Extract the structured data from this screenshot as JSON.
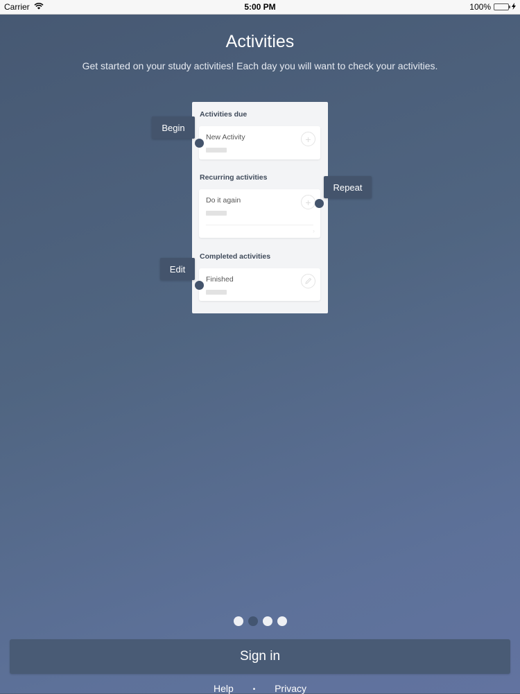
{
  "status_bar": {
    "carrier": "Carrier",
    "time": "5:00 PM",
    "battery": "100%"
  },
  "page": {
    "title": "Activities",
    "subtitle": "Get started on your study activities! Each day you will want to check your activities."
  },
  "mock": {
    "sections": [
      {
        "label": "Activities due",
        "item": "New Activity"
      },
      {
        "label": "Recurring activities",
        "item": "Do it again"
      },
      {
        "label": "Completed activities",
        "item": "Finished"
      }
    ]
  },
  "callouts": {
    "begin": "Begin",
    "repeat": "Repeat",
    "edit": "Edit"
  },
  "pager": {
    "count": 4,
    "active_index": 1
  },
  "actions": {
    "sign_in": "Sign in"
  },
  "footer": {
    "help": "Help",
    "separator": "•",
    "privacy": "Privacy"
  }
}
